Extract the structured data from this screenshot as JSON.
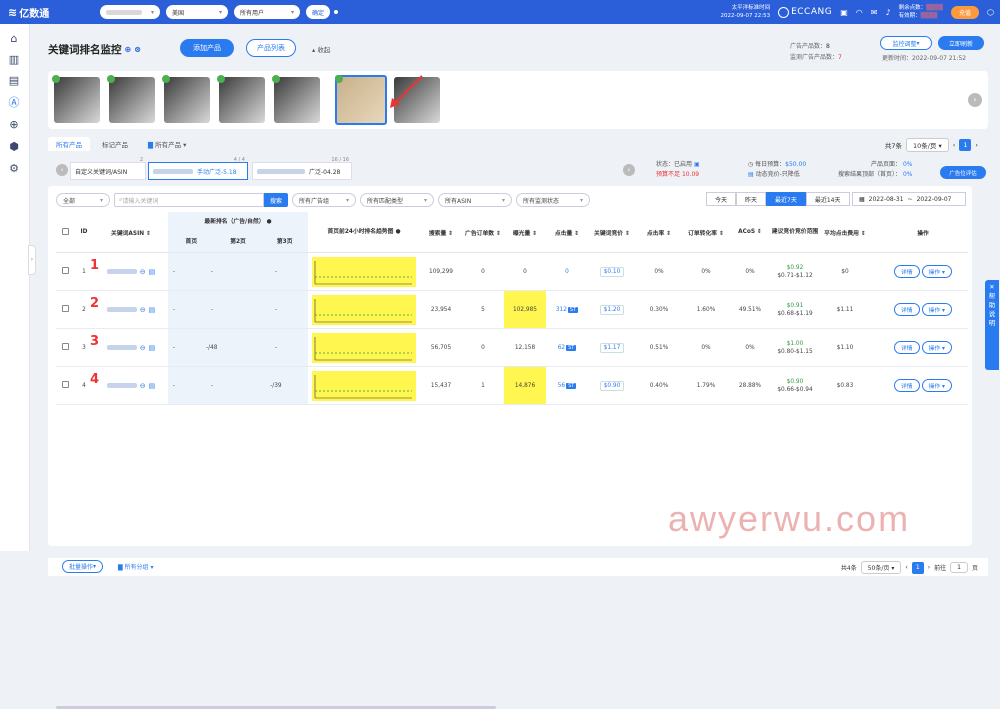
{
  "topbar": {
    "logo": "亿数通",
    "logo_sup": "12",
    "store_select": "",
    "market_select": "美国",
    "user_select": "所有用户",
    "confirm": "确定",
    "time_label": "太平洋标准时间",
    "time_value": "2022-09-07 22:53",
    "brand": "ECCANG",
    "points_label": "剩余点数：",
    "points_value": "",
    "expiry_label": "有效期：",
    "expiry_value": "",
    "renew": "充值"
  },
  "sidebar": {
    "items": [
      "home-icon",
      "chart-icon",
      "ads-icon",
      "a-icon",
      "target-icon",
      "cube-icon",
      "tools-icon"
    ]
  },
  "header": {
    "title": "关键词排名监控",
    "add_product": "添加产品",
    "product_list": "产品列表",
    "collapse": "收起",
    "ad_products_label": "广告产品数：",
    "ad_products_value": "8",
    "monitored_label": "监测广告产品数：",
    "monitored_value": "7",
    "monitor_btn": "监控调整",
    "refresh_btn": "立即刷新",
    "updated_label": "更新时间：",
    "updated_value": "2022-09-07 21:52"
  },
  "tabs": {
    "all": "所有产品",
    "marked": "标记产品",
    "group": "所有产品",
    "total": "共7条",
    "per_page": "10条/页",
    "page": "1"
  },
  "subbar": {
    "tab1": "自定义关键词/ASIN",
    "tab1_badge": "2",
    "tab2": "手动广泛-5.18",
    "tab2_badge": "4 / 4",
    "tab3": "广泛-04.28",
    "tab3_badge": "16 / 16",
    "status_label": "状态：",
    "status_value": "已启用",
    "budget_warn": "预算不足",
    "budget_warn_val": "10.09",
    "daily_budget_label": "每日预算：",
    "daily_budget": "$50.00",
    "bid_strategy": "动态竞价-只降低",
    "page_label": "产品页面：",
    "page_pct": "0%",
    "search_top_label": "搜索结果顶部（首页）：",
    "search_top_pct": "0%",
    "eval_btn": "广告位评估"
  },
  "filters": {
    "all": "全部",
    "search_placeholder": "请输入关键词",
    "search_btn": "搜索",
    "ad_group": "所有广告组",
    "match_type": "所有匹配类型",
    "asin": "所有ASIN",
    "monitor_status": "所有监测状态",
    "d_today": "今天",
    "d_yesterday": "昨天",
    "d_7": "最近7天",
    "d_14": "最近14天",
    "date_from": "2022-08-31",
    "date_sep": "~",
    "date_to": "2022-09-07"
  },
  "table": {
    "headers": {
      "id": "ID",
      "keyword": "关键词ASIN",
      "rank": "最新排名（广告/自然）",
      "p1": "首页",
      "p2": "第2页",
      "p3": "第3页",
      "trend": "首页前24小时排名趋势图",
      "search_vol": "搜索量",
      "orders": "广告订单数",
      "impressions": "曝光量",
      "clicks": "点击量",
      "bid": "关键词竞价",
      "ctr": "点击率",
      "cvr": "订单转化率",
      "acos": "ACoS",
      "suggest": "建议竞价竞价范围",
      "cpc": "平均点击费用",
      "ops": "操作"
    },
    "rows": [
      {
        "id": "1",
        "num": "1",
        "p1": "-",
        "p2": "-",
        "p3": "-",
        "vol": "109,299",
        "orders": "0",
        "imp": "0",
        "clicks": "0",
        "tag": "",
        "bid": "$0.10",
        "ctr": "0%",
        "cvr": "0%",
        "acos": "0%",
        "sug": "$0.92",
        "range": "$0.71-$1.12",
        "cpc": "$0",
        "detail": "详情",
        "op": "操作"
      },
      {
        "id": "2",
        "num": "2",
        "p1": "-",
        "p2": "-",
        "p3": "-",
        "vol": "23,954",
        "orders": "5",
        "imp": "102,985",
        "clicks": "312",
        "tag": "ST",
        "bid": "$1.20",
        "ctr": "0.30%",
        "cvr": "1.60%",
        "acos": "49.51%",
        "sug": "$0.91",
        "range": "$0.68-$1.19",
        "cpc": "$1.11",
        "detail": "详情",
        "op": "操作"
      },
      {
        "id": "3",
        "num": "3",
        "p1": "-",
        "p2": "-/48",
        "p3": "-",
        "vol": "56,705",
        "orders": "0",
        "imp": "12,158",
        "clicks": "62",
        "tag": "ST",
        "bid": "$1.17",
        "ctr": "0.51%",
        "cvr": "0%",
        "acos": "0%",
        "sug": "$1.00",
        "range": "$0.80-$1.15",
        "cpc": "$1.10",
        "detail": "详情",
        "op": "操作"
      },
      {
        "id": "4",
        "num": "4",
        "p1": "-",
        "p2": "-",
        "p3": "-/39",
        "vol": "15,437",
        "orders": "1",
        "imp": "14,876",
        "clicks": "56",
        "tag": "ST",
        "bid": "$0.90",
        "ctr": "0.40%",
        "cvr": "1.79%",
        "acos": "28.88%",
        "sug": "$0.90",
        "range": "$0.66-$0.94",
        "cpc": "$0.83",
        "detail": "详情",
        "op": "操作"
      }
    ]
  },
  "bottom": {
    "bulk": "批量操作",
    "group": "所有分组",
    "total": "共4条",
    "per_page": "50条/页",
    "page": "1",
    "goto": "前往",
    "goto_val": "1",
    "goto_unit": "页"
  },
  "helpbar": "帮助说明",
  "watermark": "awyerwu.com",
  "colors": {
    "primary": "#2b7bf0",
    "topbar": "#2b5fd9",
    "highlight": "#fff650",
    "annotation": "#e33"
  }
}
